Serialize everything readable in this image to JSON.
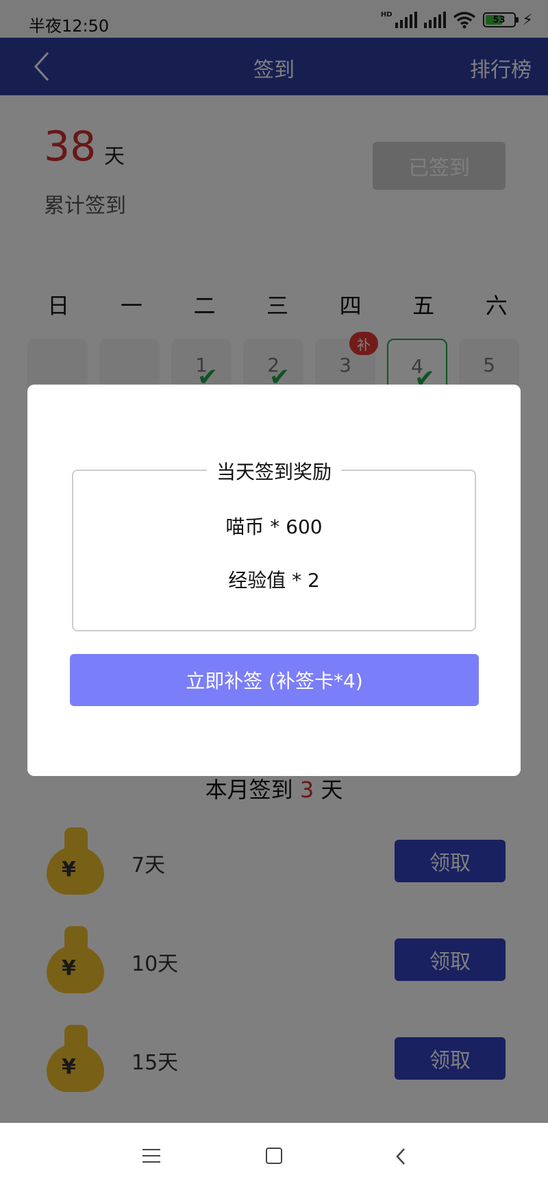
{
  "status_bar": {
    "time": "半夜12:50",
    "network_badge": "HD",
    "battery": "53"
  },
  "nav": {
    "back_icon": "chevron-left-icon",
    "title": "签到",
    "right_action": "排行榜"
  },
  "summary": {
    "total_days": "38",
    "unit": "天",
    "label": "累计签到",
    "signed_button": "已签到"
  },
  "calendar": {
    "weekdays": [
      "日",
      "一",
      "二",
      "三",
      "四",
      "五",
      "六"
    ],
    "days": [
      "1",
      "2",
      "3",
      "4",
      "5"
    ],
    "makeup_badge": "补"
  },
  "month_summary": {
    "prefix": "本月签到",
    "count": "3",
    "suffix": "天"
  },
  "rewards": [
    {
      "days": "7天",
      "button": "领取"
    },
    {
      "days": "10天",
      "button": "领取"
    },
    {
      "days": "15天",
      "button": "领取"
    }
  ],
  "modal": {
    "title": "当天签到奖励",
    "line1": "喵币 * 600",
    "line2": "经验值 * 2",
    "button": "立即补签   (补签卡*4)"
  },
  "colors": {
    "nav": "#2f3ea3",
    "accent_red": "#d32f2f",
    "check_green": "#1fa84b",
    "modal_button": "#7b7ef9",
    "claim_button": "#3242c3"
  }
}
